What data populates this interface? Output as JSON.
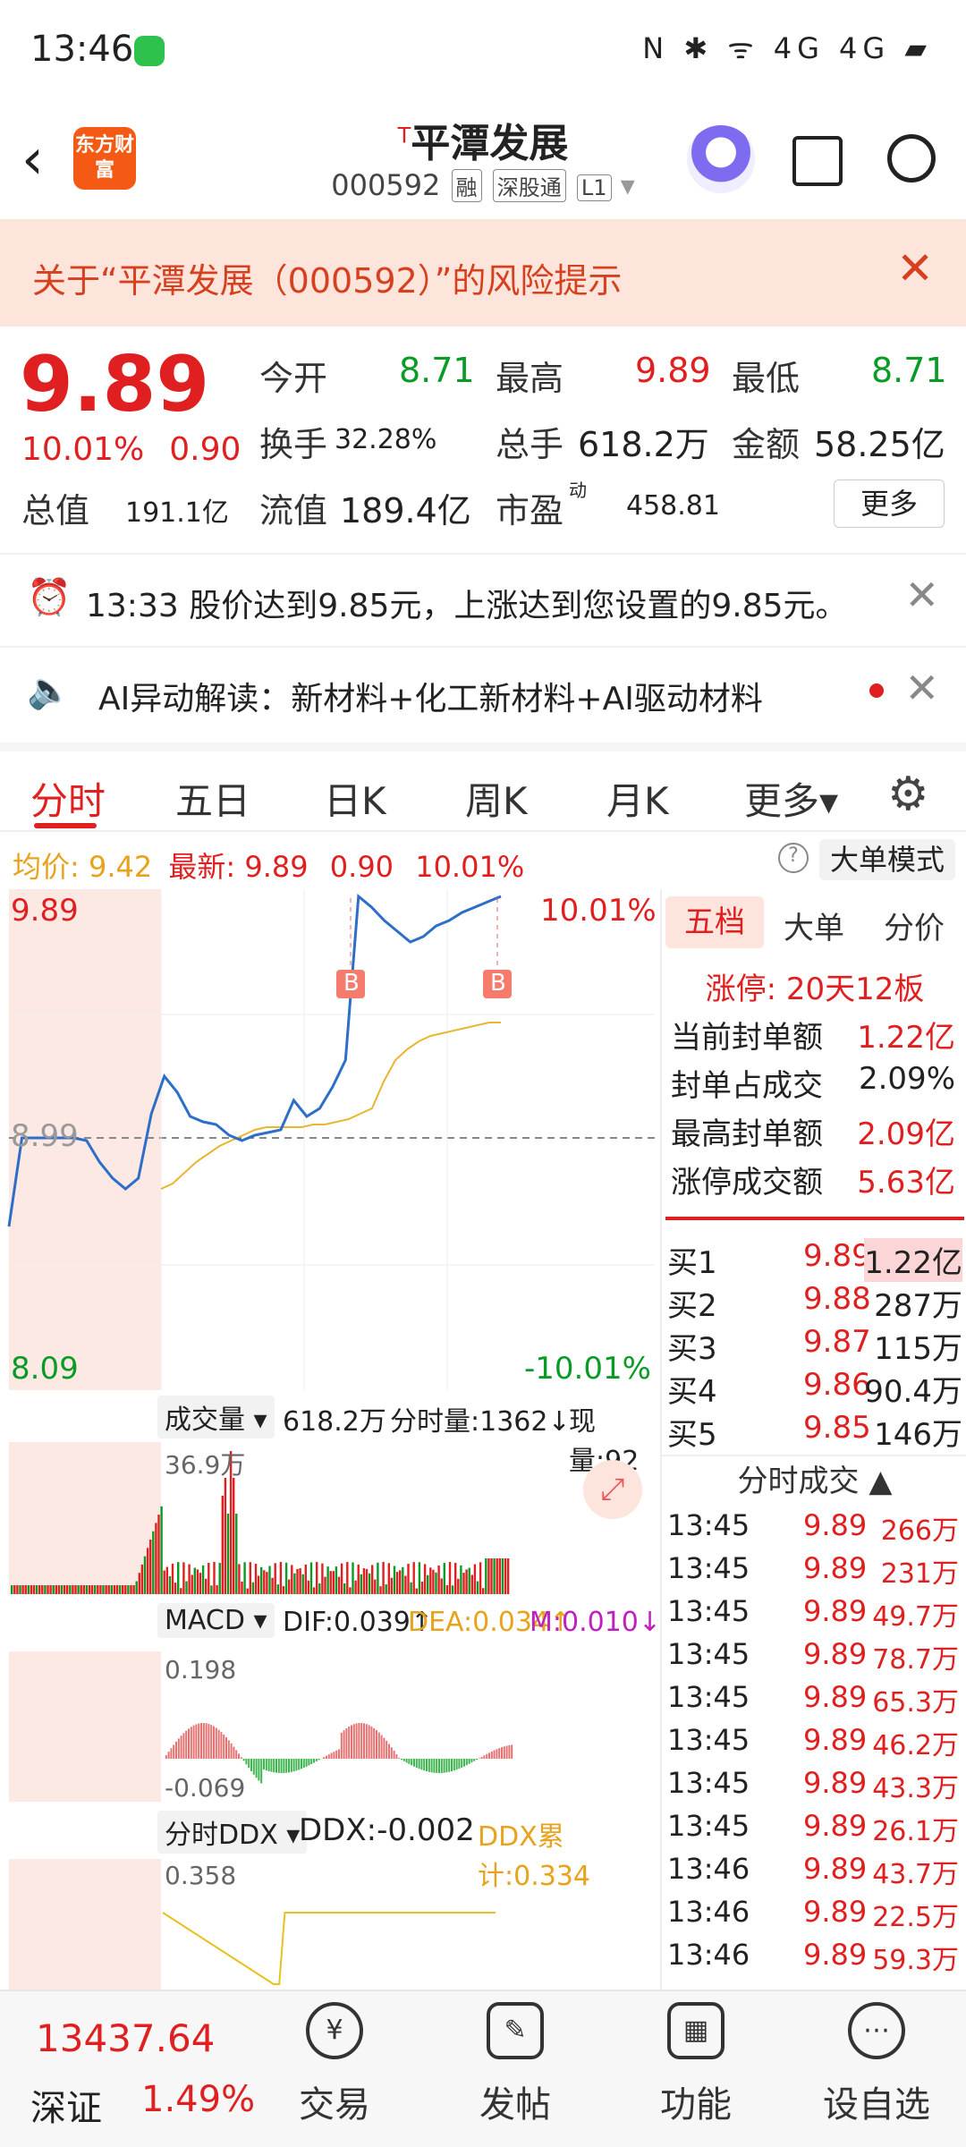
{
  "status": {
    "time": "13:46",
    "icons": "N ✱ ᯤ 4G 4G ▰"
  },
  "header": {
    "title": "平潭发展",
    "title_mark": "T",
    "code": "000592",
    "tags": [
      "融",
      "深股通",
      "L1"
    ],
    "logo": "东方财富"
  },
  "risk": {
    "text": "关于“平潭发展（000592）”的风险提示"
  },
  "quote": {
    "price": "9.89",
    "pct": "10.01%",
    "change": "0.90",
    "open_l": "今开",
    "open": "8.71",
    "high_l": "最高",
    "high": "9.89",
    "low_l": "最低",
    "low": "8.71",
    "turn_l": "换手",
    "turn": "32.28%",
    "vol_l": "总手",
    "vol": "618.2万",
    "amt_l": "金额",
    "amt": "58.25亿",
    "mcap_l": "总值",
    "mcap": "191.1亿",
    "float_l": "流值",
    "float": "189.4亿",
    "pe_l": "市盈",
    "pe_sup": "动",
    "pe": "458.81",
    "more": "更多"
  },
  "alerts": [
    {
      "text": "13:33 股价达到9.85元，上涨达到您设置的9.85元。"
    },
    {
      "text": "AI异动解读：新材料+化工新材料+AI驱动材料"
    }
  ],
  "tabs": [
    "分时",
    "五日",
    "日K",
    "周K",
    "月K",
    "更多▾"
  ],
  "pricebar": {
    "avg_l": "均价:",
    "avg": "9.42",
    "last_l": "最新:",
    "last": "9.89",
    "chg": "0.90",
    "pct": "10.01%",
    "mode": "大单模式",
    "help": "?"
  },
  "chart": {
    "price_hi": "9.89",
    "price_lo": "8.09",
    "price_mid": "8.99",
    "pct_hi": "10.01%",
    "pct_lo": "-10.01%",
    "marker": "B",
    "vol_label": "成交量",
    "vol_total": "618.2万",
    "vol_slot": "分时量:1362↓",
    "vol_now": "现量:92",
    "vol_max": "36.9万",
    "macd_label": "MACD",
    "dif": "DIF:0.039↑",
    "dea": "DEA:0.034↑",
    "m": "M:0.010↓",
    "macd_hi": "0.198",
    "macd_lo": "-0.069",
    "ddx_label": "分时DDX",
    "ddx": "DDX:-0.002",
    "ddx_sum": "DDX累计:0.334",
    "ddx_hi": "0.358"
  },
  "chart_data": {
    "type": "line",
    "title": "",
    "ylim": [
      8.09,
      9.89
    ],
    "ref_price": 8.99,
    "series": [
      {
        "name": "",
        "values": [
          8.66,
          8.99,
          8.99,
          8.99,
          8.99,
          8.99,
          8.98,
          8.9,
          8.84,
          8.8,
          8.84,
          9.08,
          9.22,
          9.16,
          9.07,
          9.05,
          9.04,
          9.0,
          8.98,
          9.0,
          9.01,
          9.02,
          9.13,
          9.07,
          9.1,
          9.18,
          9.28,
          9.89,
          9.85,
          9.8,
          9.76,
          9.72,
          9.74,
          9.78,
          9.8,
          9.83,
          9.85,
          9.87,
          9.89
        ]
      },
      {
        "name": "",
        "values": [
          8.8,
          8.82,
          8.86,
          8.9,
          8.93,
          8.96,
          8.98,
          9.0,
          9.02,
          9.03,
          9.03,
          9.03,
          9.03,
          9.04,
          9.04,
          9.05,
          9.06,
          9.08,
          9.1,
          9.2,
          9.28,
          9.32,
          9.35,
          9.37,
          9.38,
          9.39,
          9.4,
          9.41,
          9.42,
          9.42
        ]
      }
    ]
  },
  "right": {
    "tabs": [
      "五档",
      "大单",
      "分价"
    ],
    "stats": [
      {
        "l": "涨停:",
        "v": "20天12板"
      },
      {
        "l": "当前封单额",
        "v": "1.22亿"
      },
      {
        "l": "封单占成交",
        "v": "2.09%"
      },
      {
        "l": "最高封单额",
        "v": "2.09亿"
      },
      {
        "l": "涨停成交额",
        "v": "5.63亿"
      }
    ],
    "bids": [
      {
        "l": "买1",
        "p": "9.89",
        "q": "1.22亿"
      },
      {
        "l": "买2",
        "p": "9.88",
        "q": "287万"
      },
      {
        "l": "买3",
        "p": "9.87",
        "q": "115万"
      },
      {
        "l": "买4",
        "p": "9.86",
        "q": "90.4万"
      },
      {
        "l": "买5",
        "p": "9.85",
        "q": "146万"
      }
    ],
    "ticks_title": "分时成交 ▲",
    "ticks": [
      {
        "t": "13:45",
        "p": "9.89",
        "q": "266万"
      },
      {
        "t": "13:45",
        "p": "9.89",
        "q": "231万"
      },
      {
        "t": "13:45",
        "p": "9.89",
        "q": "49.7万"
      },
      {
        "t": "13:45",
        "p": "9.89",
        "q": "78.7万"
      },
      {
        "t": "13:45",
        "p": "9.89",
        "q": "65.3万"
      },
      {
        "t": "13:45",
        "p": "9.89",
        "q": "46.2万"
      },
      {
        "t": "13:45",
        "p": "9.89",
        "q": "43.3万"
      },
      {
        "t": "13:45",
        "p": "9.89",
        "q": "26.1万"
      },
      {
        "t": "13:46",
        "p": "9.89",
        "q": "43.7万"
      },
      {
        "t": "13:46",
        "p": "9.89",
        "q": "22.5万"
      },
      {
        "t": "13:46",
        "p": "9.89",
        "q": "59.3万"
      }
    ]
  },
  "bottom": {
    "index": "13437.64",
    "index_name": "深证",
    "index_pct": "1.49%",
    "nav": [
      "交易",
      "发帖",
      "功能",
      "设自选"
    ]
  }
}
